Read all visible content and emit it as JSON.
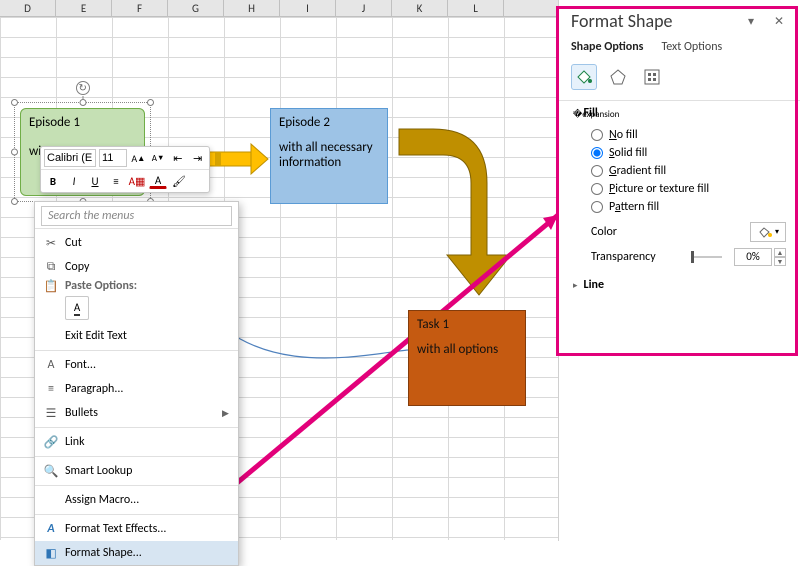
{
  "columns": [
    "D",
    "E",
    "F",
    "G",
    "H",
    "I",
    "J",
    "K",
    "L"
  ],
  "shapes": {
    "green": {
      "title": "Episode 1",
      "body": "wi"
    },
    "blue": {
      "title": "Episode 2",
      "body": "with all necessary information"
    },
    "orange": {
      "title": "Task 1",
      "body": "with all options"
    }
  },
  "minitoolbar": {
    "font": "Calibri (E",
    "size": "11",
    "buttons_row1": [
      "A▲",
      "A▼",
      "≡",
      "≡"
    ],
    "buttons_row2": [
      "B",
      "I",
      "U",
      "≡",
      "A▦",
      "A",
      "🖌"
    ]
  },
  "context_menu": {
    "search_placeholder": "Search the menus",
    "cut": "Cut",
    "copy": "Copy",
    "paste_heading": "Paste Options:",
    "paste_btn": "A",
    "exit_edit": "Exit Edit Text",
    "font": "Font...",
    "paragraph": "Paragraph...",
    "bullets": "Bullets",
    "link": "Link",
    "smart": "Smart Lookup",
    "assign": "Assign Macro...",
    "texteffects": "Format Text Effects...",
    "formatshape": "Format Shape..."
  },
  "panel": {
    "title": "Format Shape",
    "tab_shape": "Shape Options",
    "tab_text": "Text Options",
    "fill_title": "Fill",
    "nofill": "No fill",
    "solid": "Solid fill",
    "gradient": "Gradient fill",
    "picture": "Picture or texture fill",
    "pattern": "Pattern fill",
    "color_label": "Color",
    "trans_label": "Transparency",
    "trans_value": "0%",
    "line_title": "Line"
  }
}
